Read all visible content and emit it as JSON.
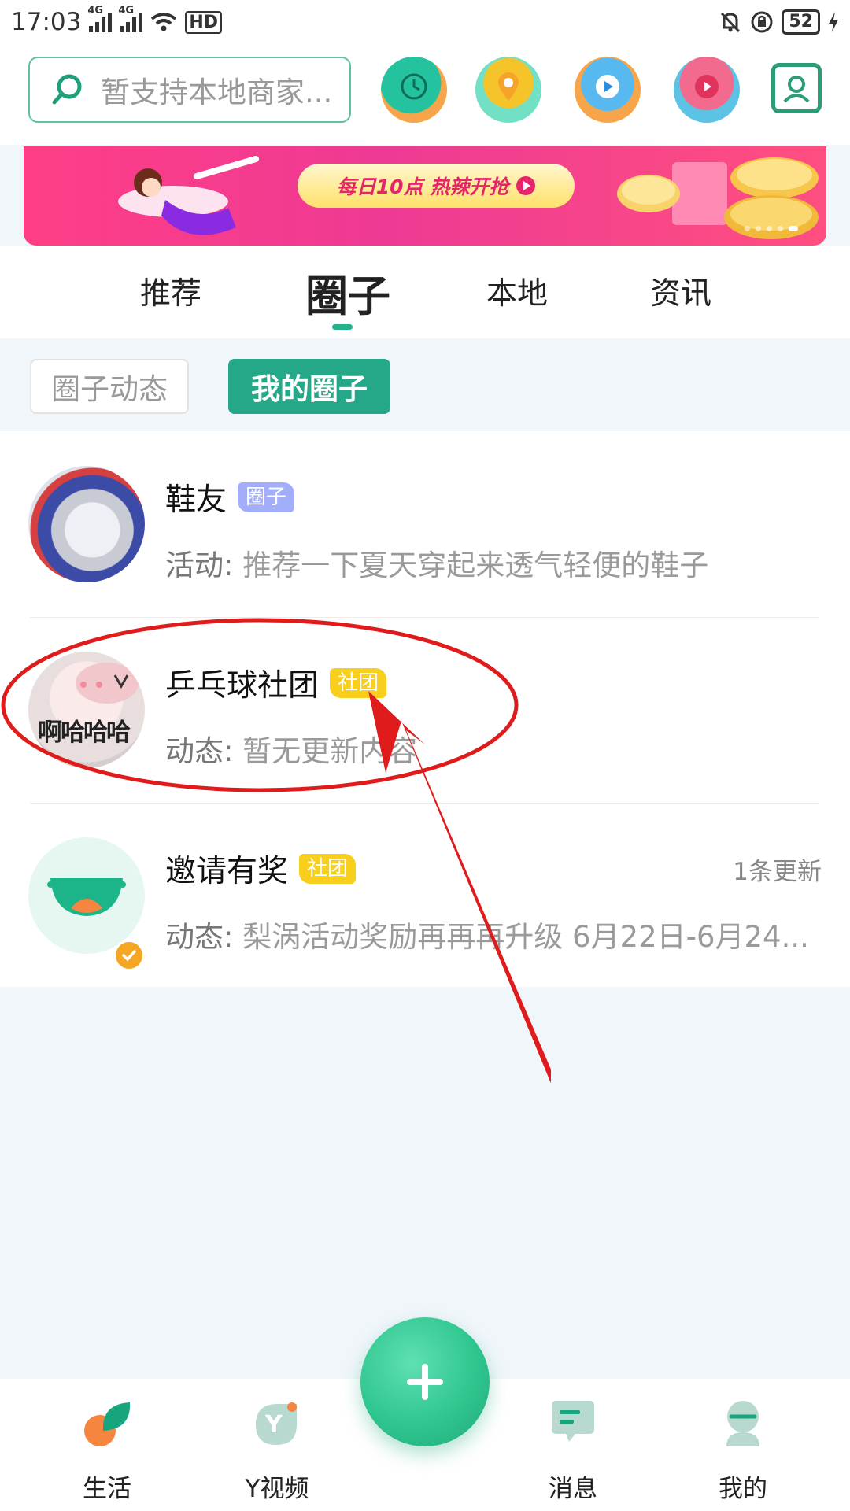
{
  "status_bar": {
    "time": "17:03",
    "network_1": "4G",
    "network_2": "4G",
    "hd": "HD",
    "battery": "52"
  },
  "header": {
    "search_placeholder": "暂支持本地商家...",
    "quick_icons": [
      "clock-icon",
      "location-pin-icon",
      "play-icon",
      "music-disc-icon"
    ],
    "profile_card_icon": "profile-card-icon"
  },
  "banner": {
    "promo_text": "每日10点 热辣开抢"
  },
  "main_tabs": [
    "推荐",
    "圈子",
    "本地",
    "资讯"
  ],
  "main_tab_active": "圈子",
  "sub_tabs": {
    "items": [
      "圈子动态",
      "我的圈子"
    ],
    "active": "我的圈子"
  },
  "circles": [
    {
      "name": "鞋友",
      "tag": "圈子",
      "label": "活动:",
      "summary": "推荐一下夏天穿起来透气轻便的鞋子",
      "update": ""
    },
    {
      "name": "乒乓球社团",
      "tag": "社团",
      "label": "动态:",
      "summary": "暂无更新内容",
      "update": "",
      "avatar_text": "啊哈哈哈"
    },
    {
      "name": "邀请有奖",
      "tag": "社团",
      "label": "动态:",
      "summary": "梨涡活动奖励再再再升级 6月22日-6月24...",
      "update": "1条更新"
    }
  ],
  "fab": {
    "icon": "plus-icon"
  },
  "bottom_nav": [
    {
      "label": "生活",
      "icon": "life-leaf-icon"
    },
    {
      "label": "Y视频",
      "icon": "y-video-icon"
    },
    {
      "label": "消息",
      "icon": "message-bubble-icon"
    },
    {
      "label": "我的",
      "icon": "profile-icon"
    }
  ],
  "colors": {
    "brand_green": "#24a887",
    "annotation_red": "#e01b1b",
    "tag_quan": "#a3aefb",
    "tag_club": "#f9cf1d"
  }
}
